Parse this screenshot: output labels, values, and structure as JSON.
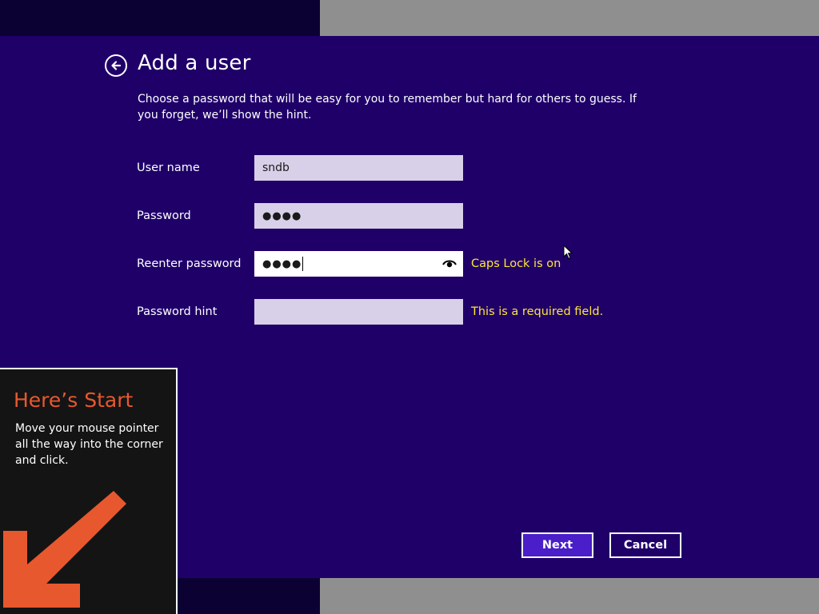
{
  "header": {
    "title": "Add a user",
    "instructions": "Choose a password that will be easy for you to remember but hard for others to guess. If you forget, we’ll show the hint."
  },
  "form": {
    "username": {
      "label": "User name",
      "value": "sndb"
    },
    "password": {
      "label": "Password",
      "value": "●●●●"
    },
    "reenter": {
      "label": "Reenter password",
      "value": "●●●●",
      "warning": "Caps Lock is on"
    },
    "hint": {
      "label": "Password hint",
      "value": "",
      "warning": "This is a required field."
    }
  },
  "buttons": {
    "next": "Next",
    "cancel": "Cancel"
  },
  "start_tip": {
    "title": "Here’s Start",
    "text": "Move your mouse pointer all the way into the corner and click."
  },
  "colors": {
    "panel": "#1f0069",
    "warning": "#ffe53c",
    "next_button": "#4a1ec8",
    "start_accent": "#e8582e"
  },
  "icons": [
    "back-arrow-icon",
    "reveal-password-icon",
    "mouse-pointer-icon",
    "start-arrow-icon"
  ]
}
